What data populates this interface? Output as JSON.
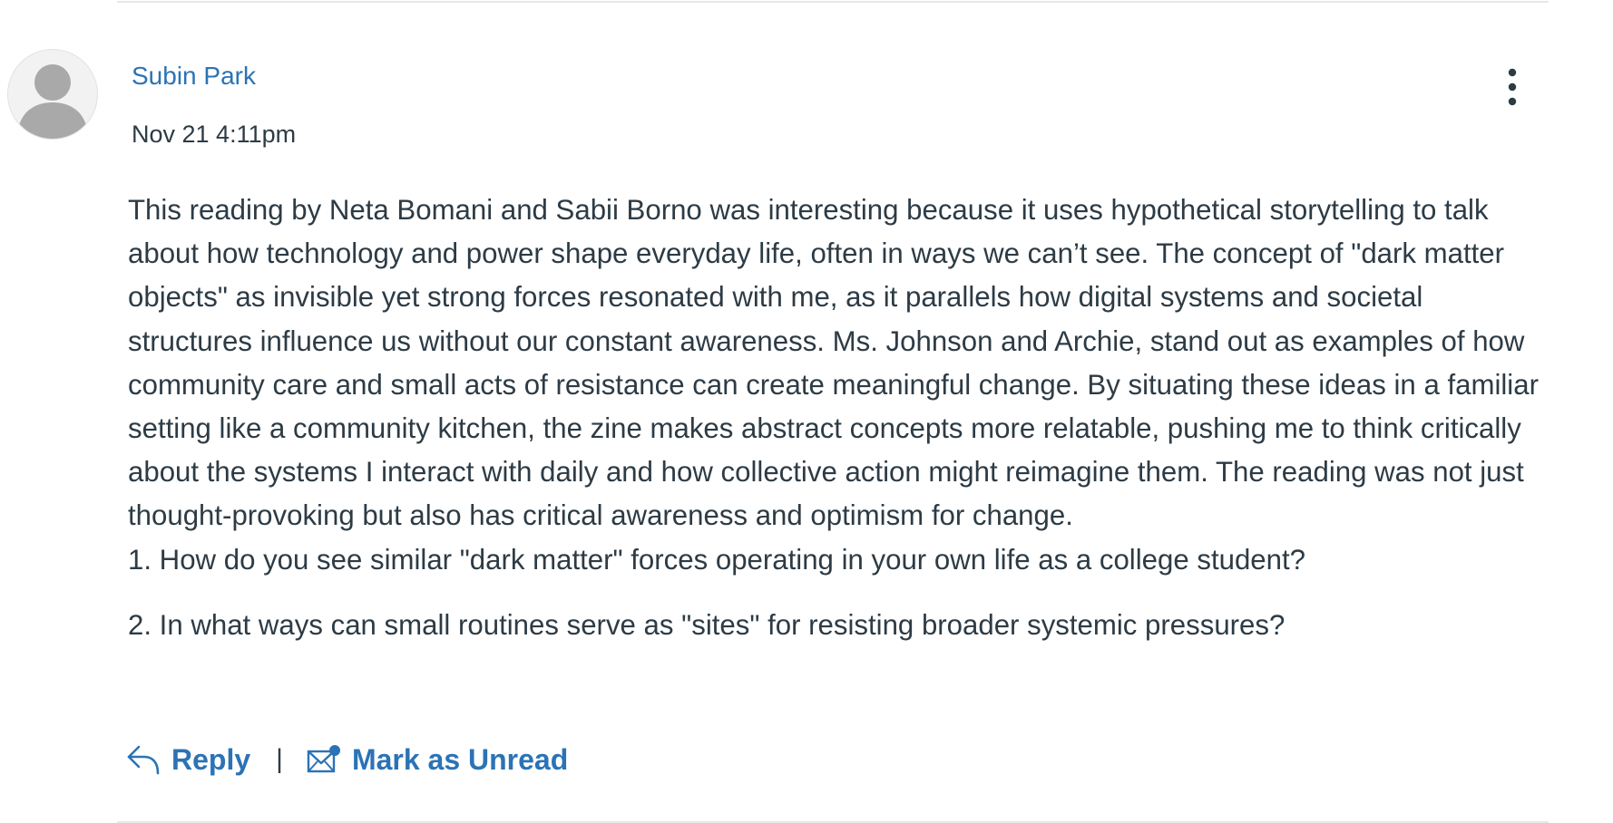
{
  "post": {
    "author": "Subin Park",
    "timestamp": "Nov 21 4:11pm",
    "paragraphs": [
      "This reading by Neta Bomani and Sabii Borno was interesting because it uses hypothetical storytelling to talk about how technology and power shape everyday life, often in ways we can’t see. The concept of \"dark matter objects\" as invisible yet strong forces resonated with me, as it parallels how digital systems and societal structures influence us without our constant awareness. Ms. Johnson and Archie, stand out as examples of how community care and small acts of resistance can create meaningful change. By situating these ideas in a familiar setting like a community kitchen, the zine makes abstract concepts more relatable, pushing me to think critically about the systems I interact with daily and how collective action might reimagine them. The reading was not just thought-provoking but also has critical awareness and optimism for change.",
      "1. How do you see similar \"dark matter\" forces operating in your own life as a college student?",
      "2. In what ways can small routines serve as \"sites\" for resisting broader systemic pressures?"
    ]
  },
  "actions": {
    "reply_label": "Reply",
    "separator": "|",
    "mark_unread_label": "Mark as Unread"
  },
  "icons": {
    "avatar": "default-avatar-icon",
    "menu": "more-options-icon",
    "reply": "reply-arrow-icon",
    "mark_unread": "envelope-unread-icon"
  },
  "colors": {
    "link": "#2b73b5",
    "text": "#2d3b45"
  }
}
